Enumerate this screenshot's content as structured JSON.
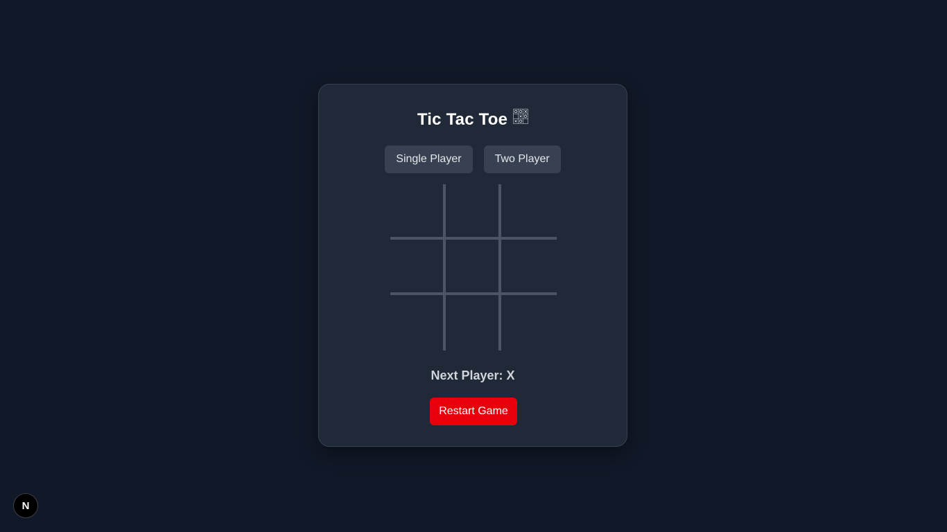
{
  "game": {
    "title": "Tic Tac Toe",
    "title_icon": "tic-tac-toe-grid-icon",
    "modes": [
      {
        "label": "Single Player"
      },
      {
        "label": "Two Player"
      }
    ],
    "board": [
      "",
      "",
      "",
      "",
      "",
      "",
      "",
      "",
      ""
    ],
    "status": "Next Player: X",
    "restart_label": "Restart Game"
  },
  "dev_badge": {
    "letter": "N",
    "icon": "nextjs-logo-icon"
  },
  "colors": {
    "background": "#111827",
    "card": "#1f2937",
    "button": "#374151",
    "grid_line": "#4b5563",
    "restart": "#e7000b"
  }
}
